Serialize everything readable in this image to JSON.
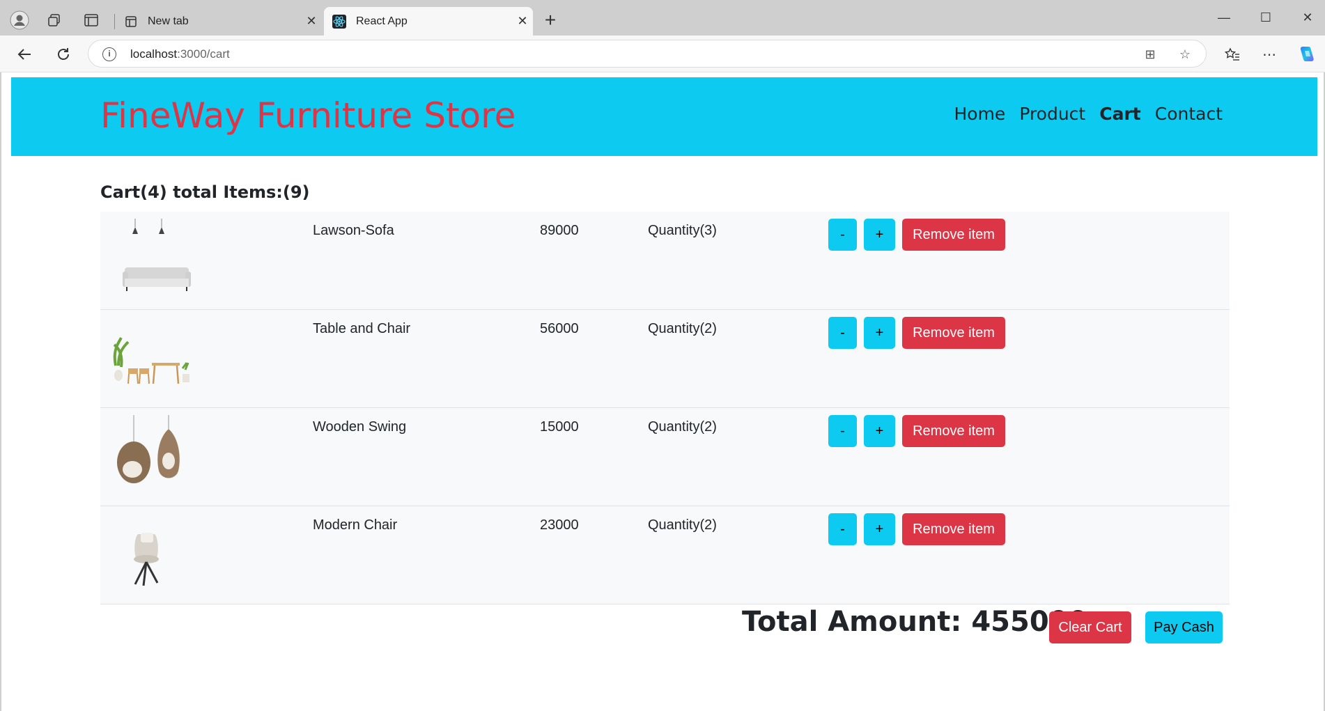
{
  "browser": {
    "tabs": [
      {
        "title": "New tab",
        "icon": "new-tab-page-icon"
      },
      {
        "title": "React App",
        "icon": "react-logo-icon"
      }
    ],
    "url_host": "localhost",
    "url_path": ":3000/cart"
  },
  "header": {
    "brand": "FineWay Furniture Store",
    "nav": [
      "Home",
      "Product",
      "Cart",
      "Contact"
    ],
    "active_nav": "Cart",
    "brand_color": "#dc3545",
    "bg_color": "#0dcaf0"
  },
  "cart": {
    "heading": "Cart(4) total Items:(9)",
    "items": [
      {
        "name": "Lawson-Sofa",
        "price": "89000",
        "quantity": "Quantity(3)",
        "image": "sofa-with-pendant-lamps"
      },
      {
        "name": "Table and Chair",
        "price": "56000",
        "quantity": "Quantity(2)",
        "image": "dining-table-set"
      },
      {
        "name": "Wooden Swing",
        "price": "15000",
        "quantity": "Quantity(2)",
        "image": "hanging-egg-chairs"
      },
      {
        "name": "Modern Chair",
        "price": "23000",
        "quantity": "Quantity(2)",
        "image": "modern-armchair"
      }
    ],
    "minus_label": "-",
    "plus_label": "+",
    "remove_label": "Remove item",
    "total": "Total Amount: 455000",
    "clear_label": "Clear Cart",
    "pay_label": "Pay Cash"
  }
}
